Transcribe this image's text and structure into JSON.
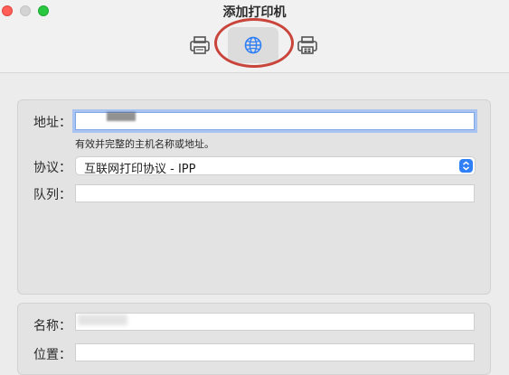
{
  "window": {
    "title": "添加打印机",
    "traffic_lights": [
      "close",
      "minimize",
      "maximize"
    ]
  },
  "toolbar": {
    "buttons": [
      {
        "icon": "printer-icon",
        "selected": false
      },
      {
        "icon": "globe-icon",
        "selected": true
      },
      {
        "icon": "windows-printer-icon",
        "selected": false
      }
    ],
    "annotation_color": "#c9443a"
  },
  "form": {
    "address": {
      "label": "地址：",
      "value": "",
      "hint": "有效并完整的主机名称或地址。"
    },
    "protocol": {
      "label": "协议：",
      "value": "互联网打印协议 - IPP"
    },
    "queue": {
      "label": "队列：",
      "value": ""
    },
    "name": {
      "label": "名称：",
      "value": ""
    },
    "location": {
      "label": "位置：",
      "value": ""
    }
  },
  "colors": {
    "accent": "#2f7ff6",
    "focus_ring": "#a9c4f1"
  }
}
